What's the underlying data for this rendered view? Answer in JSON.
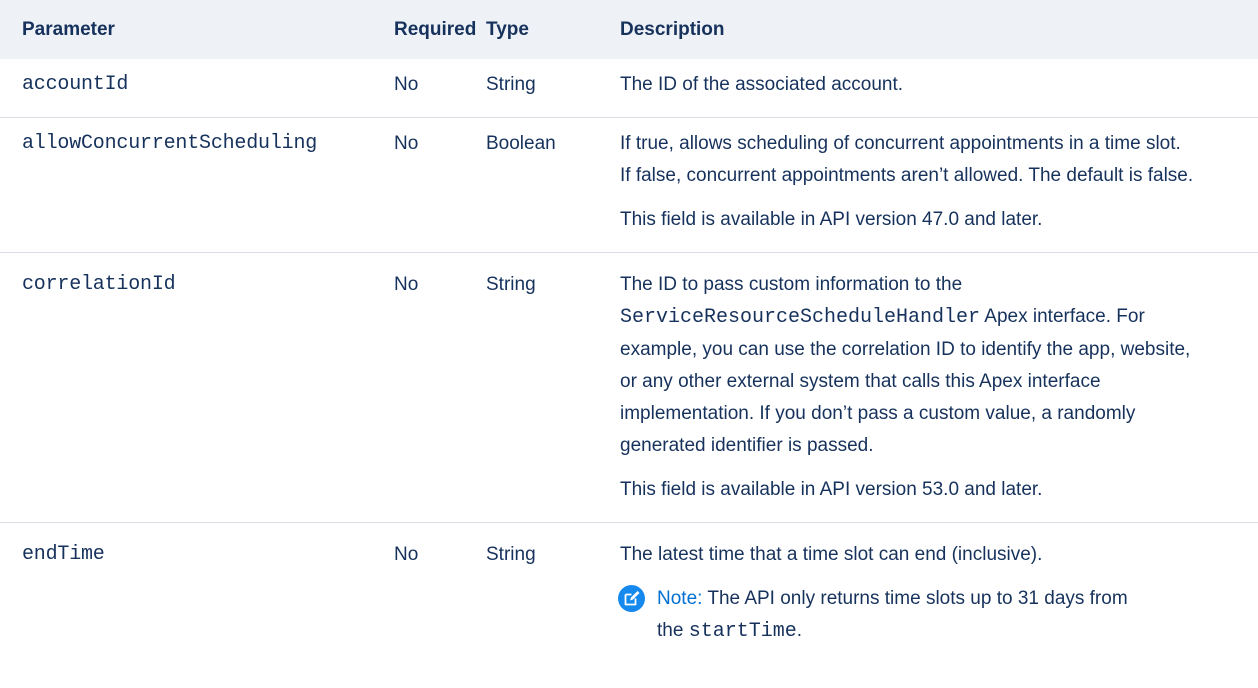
{
  "table": {
    "headers": {
      "parameter": "Parameter",
      "required": "Required",
      "type": "Type",
      "description": "Description"
    },
    "rows": [
      {
        "name": "accountId",
        "required": "No",
        "type": "String",
        "desc": [
          [
            "The ID of the associated account."
          ]
        ]
      },
      {
        "name": "allowConcurrentScheduling",
        "required": "No",
        "type": "Boolean",
        "desc": [
          [
            "If true, allows scheduling of concurrent appointments in a time slot.",
            "If false, concurrent appointments aren’t allowed. The default is false."
          ],
          [
            "This field is available in API version 47.0 and later."
          ]
        ]
      },
      {
        "name": "correlationId",
        "required": "No",
        "type": "String",
        "desc_line1": "The ID to pass custom information to the",
        "desc_code": "ServiceResourceScheduleHandler",
        "desc_after_code": " Apex interface. For",
        "desc_rest": [
          "example, you can use the correlation ID to identify the app, website,",
          "or any other external system that calls this Apex interface",
          "implementation. If you don’t pass a custom value, a randomly",
          "generated identifier is passed."
        ],
        "desc_p2": "This field is available in API version 53.0 and later."
      },
      {
        "name": "endTime",
        "required": "No",
        "type": "String",
        "desc_p1": "The latest time that a time slot can end (inclusive).",
        "note": {
          "icon": "edit-note-icon",
          "label": "Note:",
          "line1": " The API only returns time slots up to 31 days from",
          "line2_prefix": "the ",
          "line2_code": "startTime",
          "line2_suffix": "."
        }
      }
    ]
  },
  "colors": {
    "header_bg": "#eef1f6",
    "text": "#16325c",
    "note_accent": "#0070d2",
    "note_icon_bg": "#1589ee",
    "row_border": "#d8dde6"
  }
}
